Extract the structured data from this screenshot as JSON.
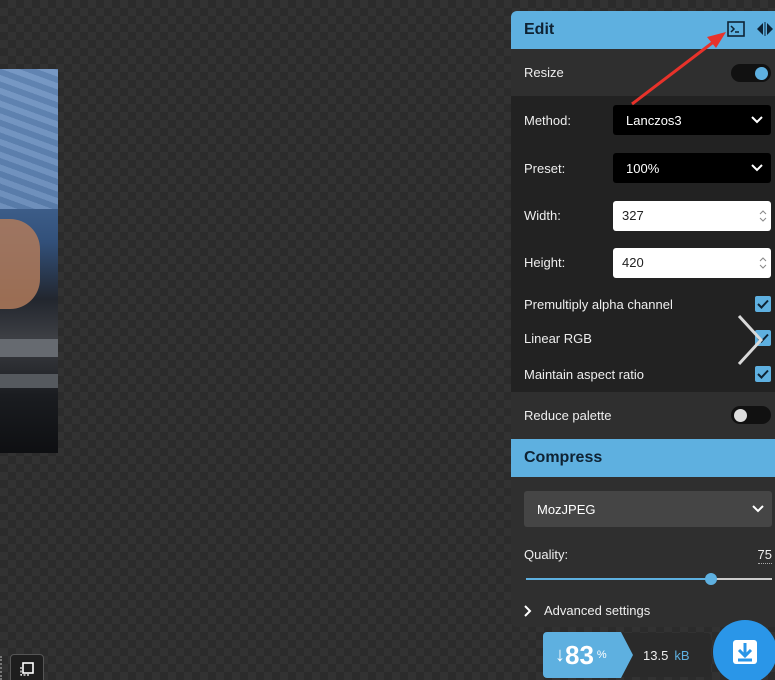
{
  "edit": {
    "title": "Edit",
    "resize_label": "Resize",
    "method_label": "Method:",
    "method_value": "Lanczos3",
    "preset_label": "Preset:",
    "preset_value": "100%",
    "width_label": "Width:",
    "width_value": "327",
    "height_label": "Height:",
    "height_value": "420",
    "premultiply_label": "Premultiply alpha channel",
    "linear_rgb_label": "Linear RGB",
    "aspect_label": "Maintain aspect ratio",
    "reduce_palette_label": "Reduce palette"
  },
  "compress": {
    "title": "Compress",
    "codec_value": "MozJPEG",
    "quality_label": "Quality:",
    "quality_value": "75",
    "quality_fraction": 0.75,
    "advanced_label": "Advanced settings"
  },
  "result": {
    "arrow": "↓",
    "percent": "83",
    "percent_sign": "%",
    "size_value": "13.5",
    "size_unit": "kB"
  },
  "colors": {
    "accent": "#5eb0e0",
    "download": "#2a96e8",
    "annotation": "#e8322a"
  },
  "icons": [
    "terminal-icon",
    "swap-sides-icon",
    "chevron-down-icon",
    "check-icon",
    "chevron-right-icon",
    "download-icon",
    "zoom-fit-icon"
  ]
}
